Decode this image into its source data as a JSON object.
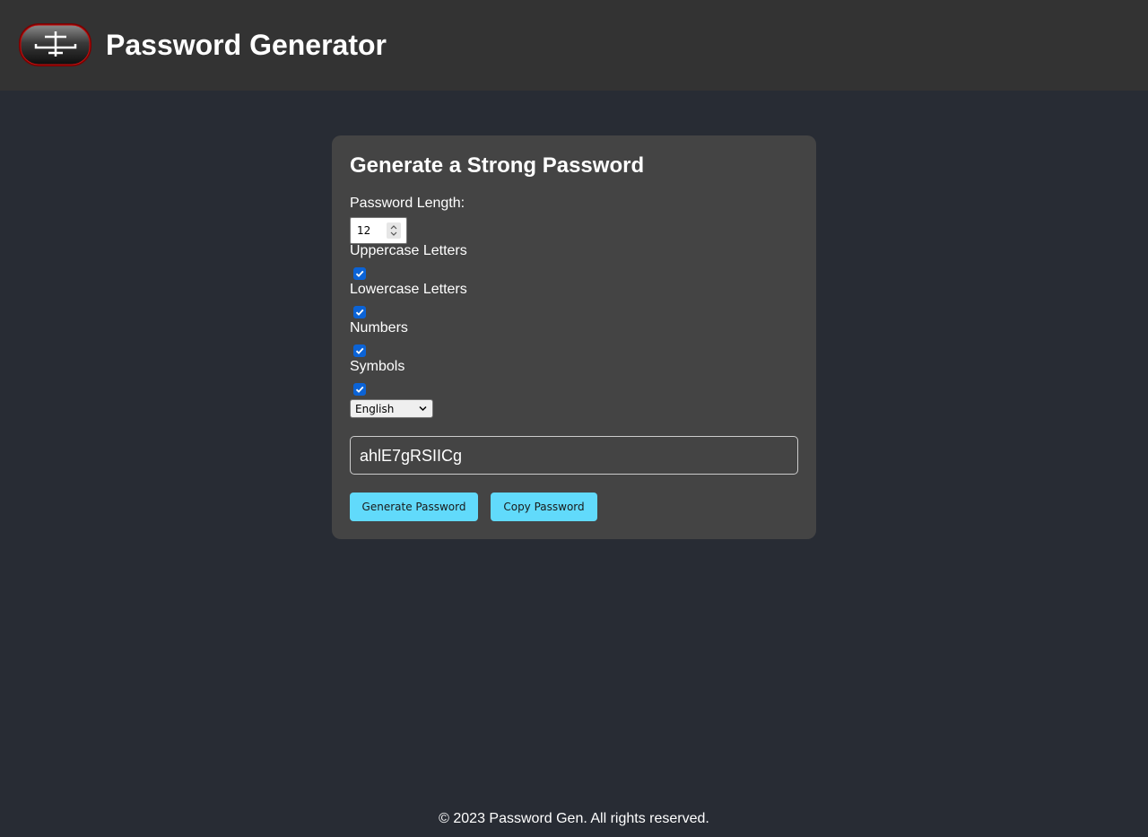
{
  "header": {
    "title": "Password Generator",
    "logo_icon": "logo-icon"
  },
  "card": {
    "title": "Generate a Strong Password",
    "length_label": "Password Length:",
    "length_value": "12",
    "options": [
      {
        "label": "Uppercase Letters",
        "checked": true
      },
      {
        "label": "Lowercase Letters",
        "checked": true
      },
      {
        "label": "Numbers",
        "checked": true
      },
      {
        "label": "Symbols",
        "checked": true
      }
    ],
    "language": "English",
    "password": "ahlE7gRSIICg",
    "generate_label": "Generate Password",
    "copy_label": "Copy Password"
  },
  "footer": {
    "text": "© 2023 Password Gen. All rights reserved."
  },
  "colors": {
    "page_bg": "#282c34",
    "header_bg": "#333333",
    "card_bg": "#444444",
    "accent": "#61dafb",
    "checkbox": "#0b63d6"
  }
}
